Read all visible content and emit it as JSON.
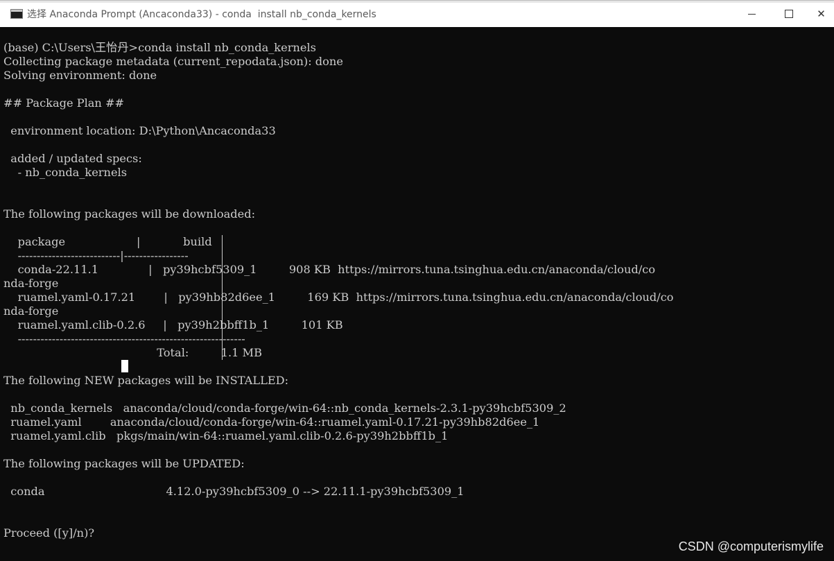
{
  "window": {
    "title": "选择 Anaconda Prompt (Ancaconda33) - conda  install nb_conda_kernels",
    "icons": {
      "app": "console-icon",
      "minimize": "minimize-icon",
      "maximize": "maximize-icon",
      "close": "close-icon"
    },
    "close_glyph": "✕"
  },
  "console": {
    "lines": [
      "(base) C:\\Users\\王怡丹>conda install nb_conda_kernels",
      "Collecting package metadata (current_repodata.json): done",
      "Solving environment: done",
      "",
      "## Package Plan ##",
      "",
      "  environment location: D:\\Python\\Ancaconda33",
      "",
      "  added / updated specs:",
      "    - nb_conda_kernels",
      "",
      "",
      "The following packages will be downloaded:",
      "",
      "    package                    |            build",
      "    ---------------------------|-----------------",
      "    conda-22.11.1              |   py39hcbf5309_1         908 KB  https://mirrors.tuna.tsinghua.edu.cn/anaconda/cloud/co",
      "nda-forge",
      "    ruamel.yaml-0.17.21        |   py39hb82d6ee_1         169 KB  https://mirrors.tuna.tsinghua.edu.cn/anaconda/cloud/co",
      "nda-forge",
      "    ruamel.yaml.clib-0.2.6     |   py39h2bbff1b_1         101 KB",
      "    ------------------------------------------------------------",
      "                                           Total:         1.1 MB",
      "",
      "The following NEW packages will be INSTALLED:",
      "",
      "  nb_conda_kernels   anaconda/cloud/conda-forge/win-64::nb_conda_kernels-2.3.1-py39hcbf5309_2",
      "  ruamel.yaml        anaconda/cloud/conda-forge/win-64::ruamel.yaml-0.17.21-py39hb82d6ee_1",
      "  ruamel.yaml.clib   pkgs/main/win-64::ruamel.yaml.clib-0.2.6-py39h2bbff1b_1",
      "",
      "The following packages will be UPDATED:",
      "",
      "  conda                                  4.12.0-py39hcbf5309_0 --> 22.11.1-py39hcbf5309_1",
      "",
      "",
      "Proceed ([y]/n)?"
    ]
  },
  "watermark": "CSDN @computerismylife"
}
